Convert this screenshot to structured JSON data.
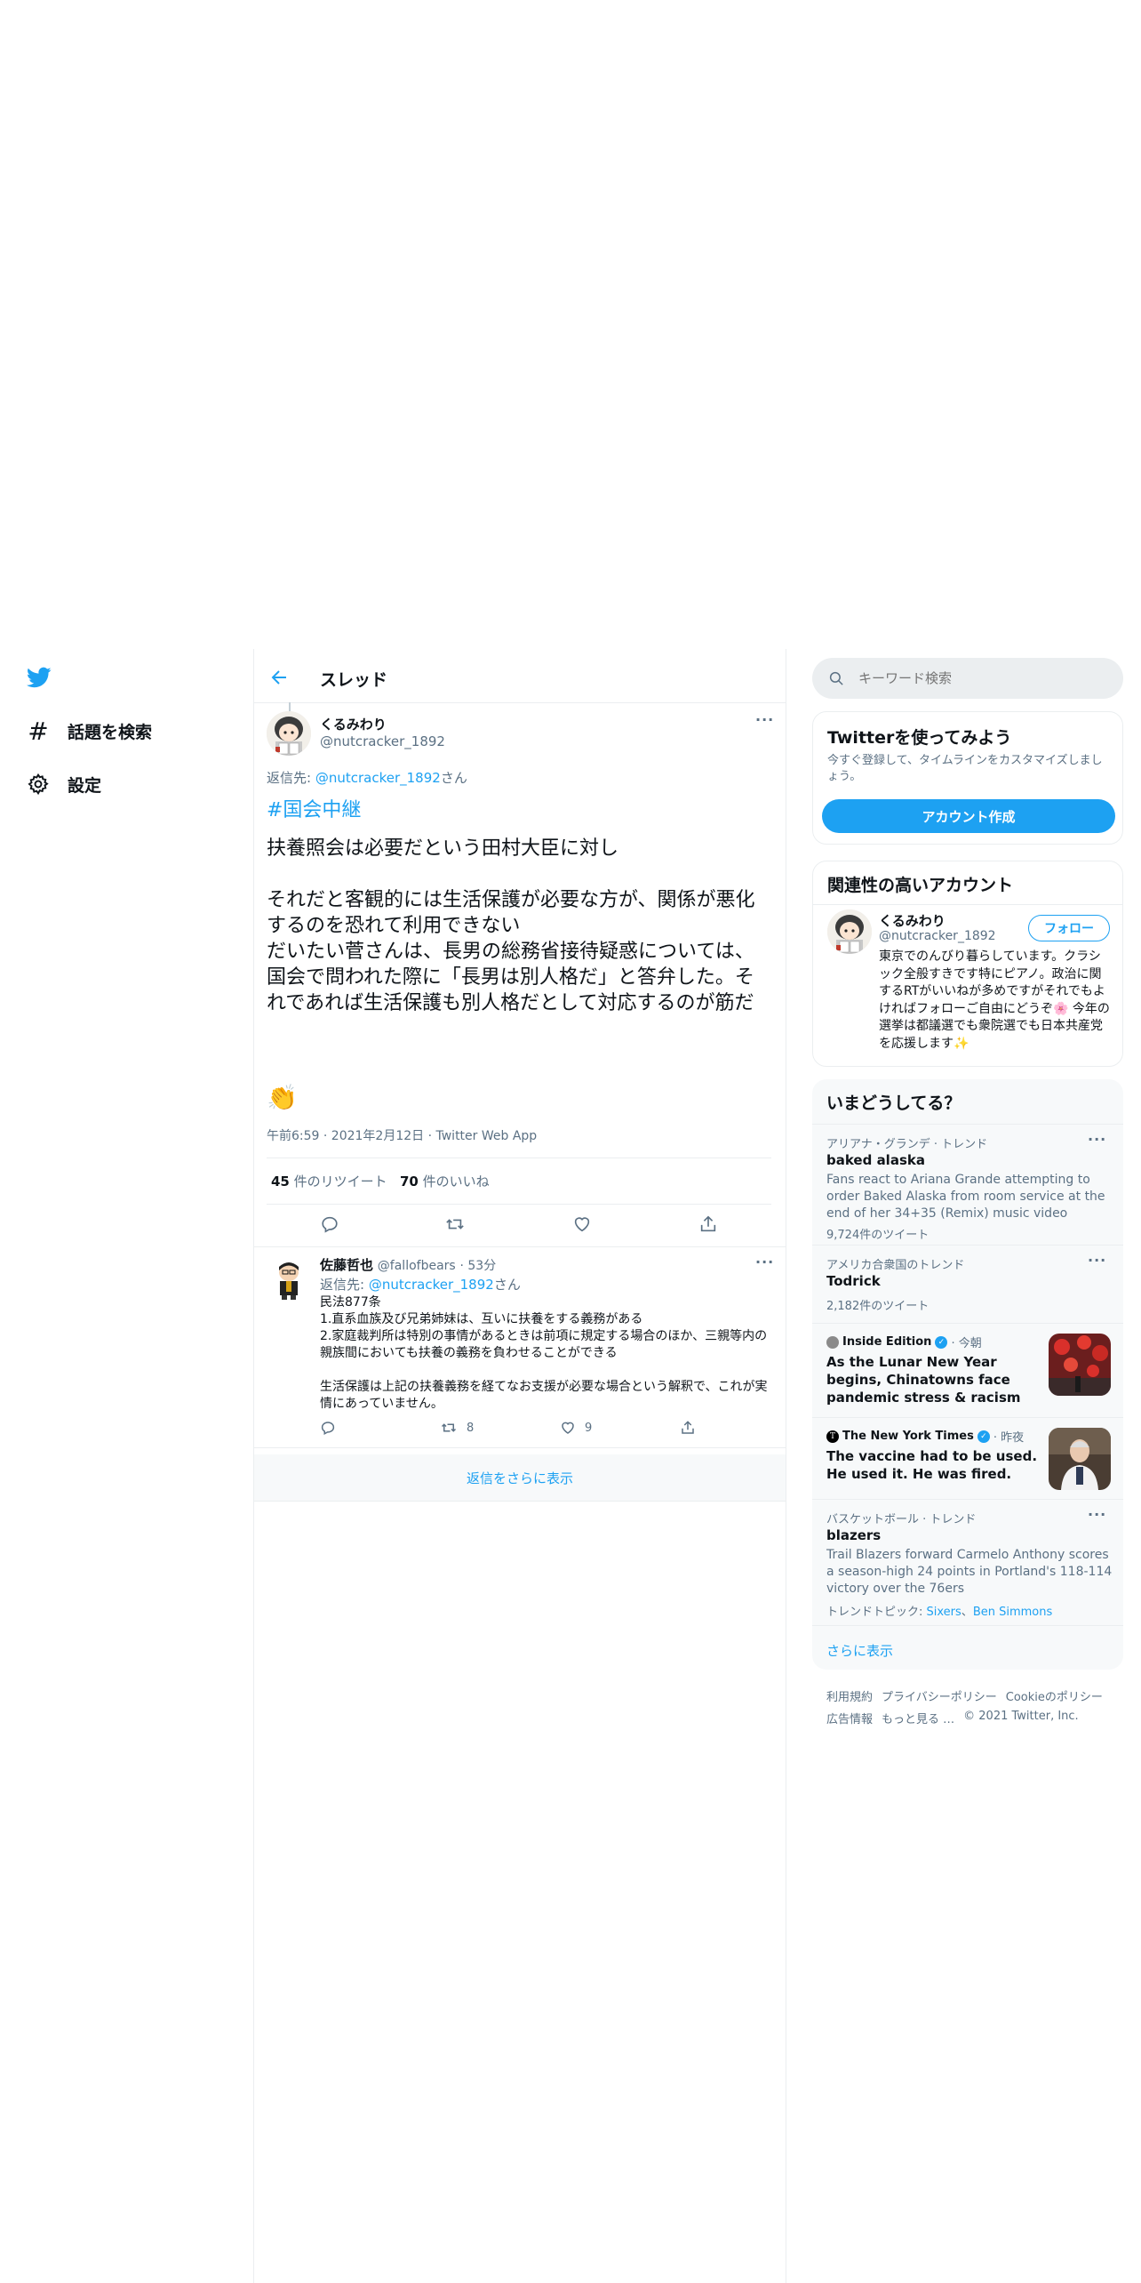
{
  "nav": {
    "explore_label": "話題を検索",
    "settings_label": "設定",
    "twitter_icon": "twitter-bird-icon",
    "accent": "#1da1f2"
  },
  "header": {
    "title": "スレッド"
  },
  "main_tweet": {
    "display_name": "くるみわり",
    "handle": "@nutcracker_1892",
    "reply_prefix": "返信先: ",
    "reply_to": "@nutcracker_1892",
    "reply_suffix": "さん",
    "hashtag": "#国会中継",
    "body": "扶養照会は必要だという田村大臣に対し\n\nそれだと客観的には生活保護が必要な方が、関係が悪化するのを恐れて利用できない\nだいたい菅さんは、長男の総務省接待疑惑については、国会で問われた際に「長男は別人格だ」と答弁した。それであれば生活保護も別人格だとして対応するのが筋だ",
    "emoji": "👏",
    "timestamp": "午前6:59 · 2021年2月12日 · Twitter Web App",
    "retweet_count": "45",
    "retweet_label": " 件のリツイート",
    "like_count": "70",
    "like_label": " 件のいいね"
  },
  "reply_tweet": {
    "display_name": "佐藤哲也",
    "handle": "@fallofbears",
    "time": "· 53分",
    "reply_prefix": "返信先: ",
    "reply_to": "@nutcracker_1892",
    "reply_suffix": "さん",
    "body": "民法877条\n1.直系血族及び兄弟姉妹は、互いに扶養をする義務がある\n2.家庭裁判所は特別の事情があるときは前項に規定する場合のほか、三親等内の親族間においても扶養の義務を負わせることができる\n\n生活保護は上記の扶養義務を経てなお支援が必要な場合という解釈で、これが実情にあっていません。",
    "retweets": "8",
    "likes": "9"
  },
  "show_more_replies": "返信をさらに表示",
  "search": {
    "placeholder": "キーワード検索"
  },
  "signup_card": {
    "title": "Twitterを使ってみよう",
    "desc": "今すぐ登録して、タイムラインをカスタマイズしましょう。",
    "button": "アカウント作成"
  },
  "related_card": {
    "title": "関連性の高いアカウント",
    "name": "くるみわり",
    "handle": "@nutcracker_1892",
    "follow": "フォロー",
    "bio": "東京でのんびり暮らしています。クラシック全般すきです特にピアノ。政治に関するRTがいいねが多めですがそれでもよければフォローご自由にどうぞ🌸 今年の選挙は都議選でも衆院選でも日本共産党を応援します✨"
  },
  "trends": {
    "title": "いまどうしてる？",
    "items": [
      {
        "meta": "アリアナ・グランデ · トレンド",
        "name": "baked alaska",
        "desc": "Fans react to Ariana Grande attempting to order Baked Alaska from room service at the end of her 34+35 (Remix) music video",
        "count": "9,724件のツイート"
      },
      {
        "meta": "アメリカ合衆国のトレンド",
        "name": "Todrick",
        "count": "2,182件のツイート"
      },
      {
        "source": "Inside Edition",
        "time": "· 今朝",
        "headline": "As the Lunar New Year begins, Chinatowns face pandemic stress & racism"
      },
      {
        "source": "The New York Times",
        "time": "· 昨夜",
        "headline": "The vaccine had to be used. He used it. He was fired."
      },
      {
        "meta": "バスケットボール · トレンド",
        "name": "blazers",
        "desc": "Trail Blazers forward Carmelo Anthony scores a season-high 24 points in Portland's 118-114 victory over the 76ers",
        "topics_label": "トレンドトピック: ",
        "topic1": "Sixers",
        "topic_sep": "、",
        "topic2": "Ben Simmons"
      }
    ],
    "show_more": "さらに表示"
  },
  "footer": {
    "terms": "利用規約",
    "privacy": "プライバシーポリシー",
    "cookies": "Cookieのポリシー",
    "ads": "広告情報",
    "more": "もっと見る …",
    "copyright": "© 2021 Twitter, Inc."
  }
}
